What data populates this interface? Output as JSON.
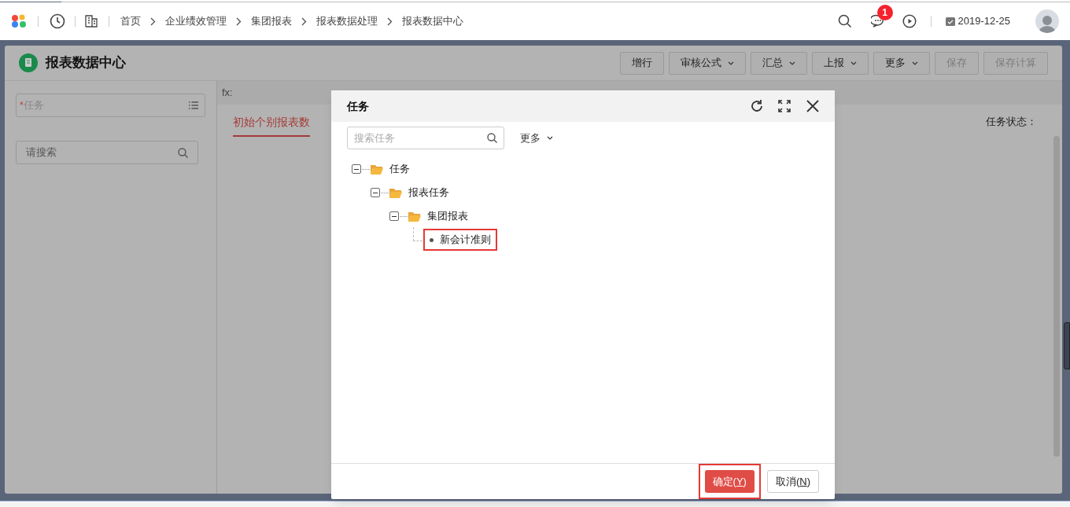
{
  "topbar": {
    "breadcrumb": [
      "首页",
      "企业绩效管理",
      "集团报表",
      "报表数据处理",
      "报表数据中心"
    ],
    "notification_count": "1",
    "date": "2019-12-25"
  },
  "page": {
    "title": "报表数据中心",
    "toolbar": [
      {
        "label": "增行",
        "dropdown": false,
        "disabled": false
      },
      {
        "label": "审核公式",
        "dropdown": true,
        "disabled": false
      },
      {
        "label": "汇总",
        "dropdown": true,
        "disabled": false
      },
      {
        "label": "上报",
        "dropdown": true,
        "disabled": false
      },
      {
        "label": "更多",
        "dropdown": true,
        "disabled": false
      },
      {
        "label": "保存",
        "dropdown": false,
        "disabled": true
      },
      {
        "label": "保存计算",
        "dropdown": false,
        "disabled": true
      }
    ],
    "task_field": {
      "placeholder": "任务",
      "required": true,
      "required_mark": "*"
    },
    "search": {
      "placeholder": "请搜索"
    },
    "formula_label": "fx:",
    "tabs": [
      {
        "label": "初始个别报表数",
        "selected": true
      }
    ],
    "status_label": "任务状态："
  },
  "dialog": {
    "title": "任务",
    "search": {
      "placeholder": "搜索任务"
    },
    "more": "更多",
    "tree": [
      {
        "label": "任务",
        "kind": "folder",
        "expanded": true,
        "highlighted": false,
        "children": [
          {
            "label": "报表任务",
            "kind": "folder",
            "expanded": true,
            "highlighted": false,
            "children": [
              {
                "label": "集团报表",
                "kind": "folder",
                "expanded": true,
                "highlighted": false,
                "children": [
                  {
                    "label": "新会计准则",
                    "kind": "leaf",
                    "highlighted": true
                  }
                ]
              }
            ]
          }
        ]
      }
    ],
    "buttons": [
      {
        "label": "确定(",
        "mnemonic": "Y",
        "suffix": ")",
        "kind": "primary",
        "highlighted": true
      },
      {
        "label": "取消(",
        "mnemonic": "N",
        "suffix": ")",
        "kind": "secondary",
        "highlighted": false
      }
    ]
  }
}
